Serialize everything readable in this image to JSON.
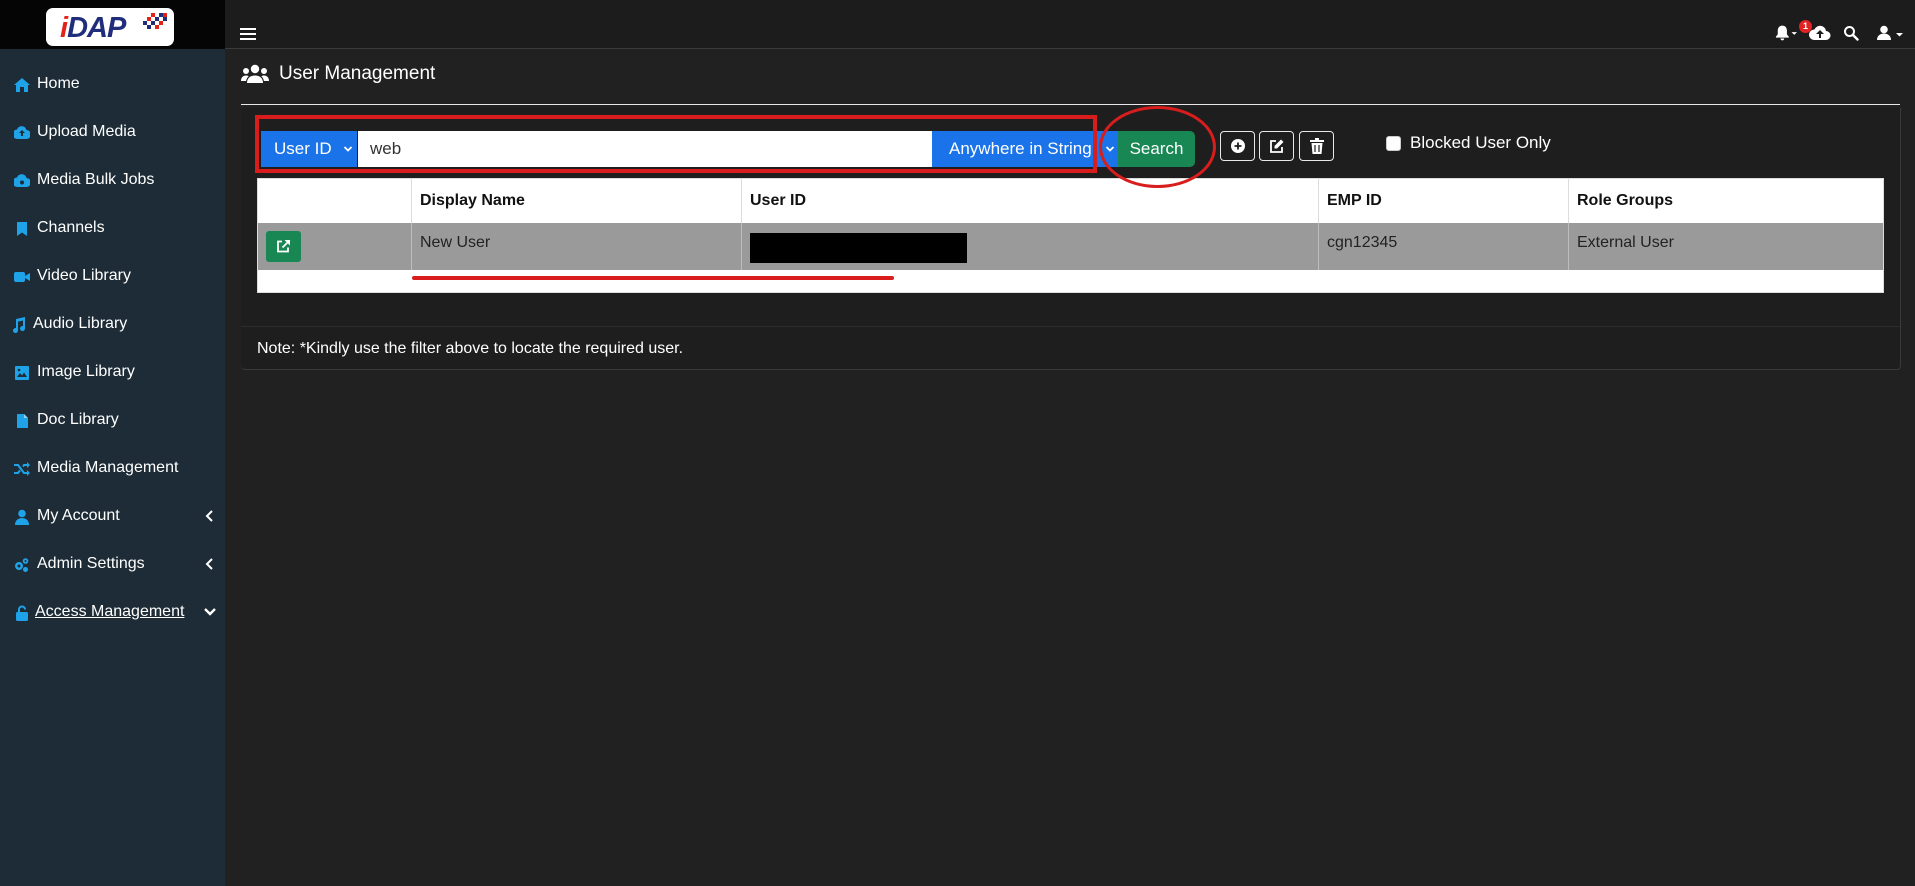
{
  "brand": {
    "logo_text": "iDAP"
  },
  "topbar": {
    "notification_count": "1",
    "icons": [
      "menu-icon",
      "bell-icon",
      "cloud-upload-icon",
      "search-icon",
      "user-icon"
    ]
  },
  "sidebar": {
    "items": [
      {
        "label": "Home",
        "icon": "home-icon"
      },
      {
        "label": "Upload Media",
        "icon": "cloud-upload-icon"
      },
      {
        "label": "Media Bulk Jobs",
        "icon": "cloud-icon"
      },
      {
        "label": "Channels",
        "icon": "bookmark-icon"
      },
      {
        "label": "Video Library",
        "icon": "video-icon"
      },
      {
        "label": "Audio Library",
        "icon": "music-icon"
      },
      {
        "label": "Image Library",
        "icon": "image-icon"
      },
      {
        "label": "Doc Library",
        "icon": "file-icon"
      },
      {
        "label": "Media Management",
        "icon": "shuffle-icon"
      },
      {
        "label": "My Account",
        "icon": "user-icon"
      },
      {
        "label": "Admin Settings",
        "icon": "cogs-icon"
      },
      {
        "label": "Access Management",
        "icon": "unlock-icon"
      }
    ]
  },
  "page": {
    "title": "User Management"
  },
  "filter": {
    "field": "User ID",
    "query": "web",
    "match_mode": "Anywhere in String",
    "search_label": "Search",
    "blocked_only_label": "Blocked User Only"
  },
  "table": {
    "columns": [
      "",
      "Display Name",
      "User ID",
      "EMP ID",
      "Role Groups"
    ],
    "rows": [
      {
        "display_name": "New User",
        "user_id": "",
        "emp_id": "cgn12345",
        "role_groups": "External User"
      }
    ]
  },
  "note": "Note: *Kindly use the filter above to locate the required user.",
  "colors": {
    "sidebar_bg": "#1d2c36",
    "accent_icon": "#1fa3e8",
    "primary": "#1a73e8",
    "success": "#198754",
    "annotation": "#d91d1d"
  }
}
